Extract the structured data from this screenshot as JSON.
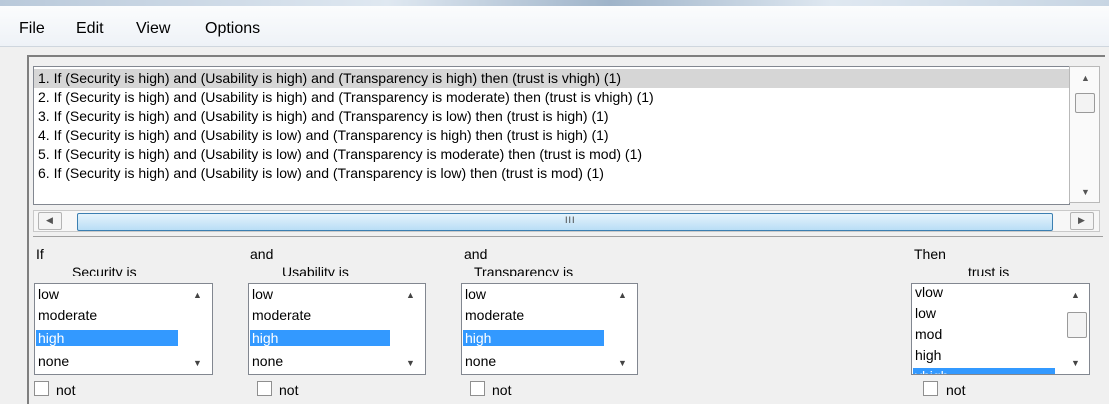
{
  "menu": {
    "file": "File",
    "edit": "Edit",
    "view": "View",
    "options": "Options"
  },
  "rules": [
    "1. If (Security is high) and (Usability is high) and (Transparency is high) then (trust is vhigh) (1)",
    "2. If (Security is high) and (Usability is high) and (Transparency is moderate) then (trust is vhigh) (1)",
    "3. If (Security is high) and (Usability is high) and (Transparency is low) then (trust is high) (1)",
    "4. If (Security is high) and (Usability is low) and (Transparency is high) then (trust is high) (1)",
    "5. If (Security is high) and (Usability is low) and (Transparency is moderate) then (trust is mod) (1)",
    "6. If (Security is high) and (Usability is low) and (Transparency is low) then (trust is mod) (1)"
  ],
  "hscroll": {
    "grip": "III"
  },
  "antecedents": [
    {
      "connector": "If",
      "title": "Security is",
      "options": [
        "low",
        "moderate",
        "high",
        "none"
      ],
      "selected": "high",
      "not_label": "not"
    },
    {
      "connector": "and",
      "title": "Usability is",
      "options": [
        "low",
        "moderate",
        "high",
        "none"
      ],
      "selected": "high",
      "not_label": "not"
    },
    {
      "connector": "and",
      "title": "Transparency is",
      "options": [
        "low",
        "moderate",
        "high",
        "none"
      ],
      "selected": "high",
      "not_label": "not"
    }
  ],
  "consequent": {
    "connector": "Then",
    "title": "trust is",
    "options": [
      "vlow",
      "low",
      "mod",
      "high",
      "vhigh"
    ],
    "selected": "vhigh",
    "not_label": "not"
  },
  "icons": {
    "up": "▲",
    "down": "▼",
    "left": "◀",
    "right": "▶"
  },
  "colors": {
    "selection": "#3399ff",
    "rule_selection": "#d6d6d6"
  }
}
